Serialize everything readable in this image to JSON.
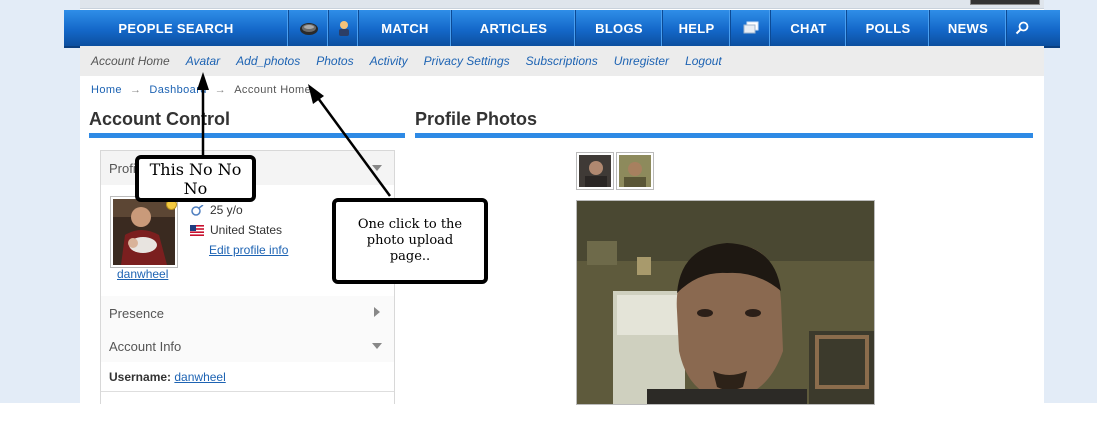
{
  "main_nav": [
    {
      "label": "PEOPLE SEARCH",
      "type": "text"
    },
    {
      "label": "",
      "type": "icon",
      "icon": "messages-icon"
    },
    {
      "label": "",
      "type": "icon",
      "icon": "user-profile-icon"
    },
    {
      "label": "MATCH",
      "type": "text"
    },
    {
      "label": "ARTICLES",
      "type": "text"
    },
    {
      "label": "BLOGS",
      "type": "text"
    },
    {
      "label": "HELP",
      "type": "text"
    },
    {
      "label": "",
      "type": "icon",
      "icon": "windows-icon"
    },
    {
      "label": "CHAT",
      "type": "text"
    },
    {
      "label": "POLLS",
      "type": "text"
    },
    {
      "label": "NEWS",
      "type": "text"
    },
    {
      "label": "",
      "type": "icon",
      "icon": "search-icon"
    }
  ],
  "sub_nav": {
    "current": "Account Home",
    "links": [
      "Avatar",
      "Add_photos",
      "Photos",
      "Activity",
      "Privacy Settings",
      "Subscriptions",
      "Unregister",
      "Logout"
    ]
  },
  "breadcrumb": {
    "items": [
      "Home",
      "Dashboard",
      "Account Home"
    ],
    "separator": "→"
  },
  "left_panel": {
    "title": "Account Control",
    "profile_header": "Profile",
    "age": "25 y/o",
    "country": "United States",
    "edit_link": "Edit profile info",
    "avatar_name": "danwheel",
    "presence_header": "Presence",
    "account_info_header": "Account Info",
    "username_label": "Username:",
    "username_value": "danwheel"
  },
  "right_panel": {
    "title": "Profile Photos",
    "thumbnail_count": 2
  },
  "annotations": {
    "callout1": "This No No No",
    "callout2": "One click to the photo upload page.."
  },
  "colors": {
    "nav_blue": "#1468c9",
    "link_blue": "#1d63b3",
    "accent_bar": "#2e8ae5"
  }
}
